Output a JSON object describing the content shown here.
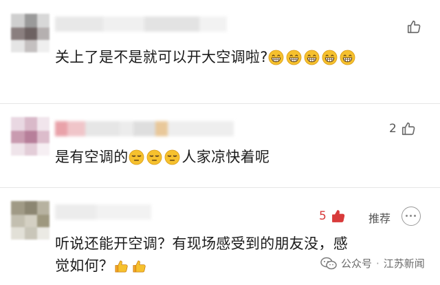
{
  "comments": [
    {
      "text": "关上了是不是就可以开大空调啦?",
      "emoji_name": "grinning-face-icon",
      "emoji_count": 5,
      "like_count": ""
    },
    {
      "text_before": "是有空调的",
      "emoji_name": "unamused-face-icon",
      "emoji_count": 3,
      "text_after": "人家凉快着呢",
      "like_count": "2"
    },
    {
      "line1": "听说还能开空调？有现场感受到的朋友没，感",
      "line2": "觉如何？",
      "emoji_name": "thumbs-up-icon",
      "emoji_count": 2,
      "like_count": "5",
      "recommend_label": "推荐"
    }
  ],
  "watermark": {
    "channel": "公众号",
    "separator": "·",
    "account": "江苏新闻"
  },
  "colors": {
    "text": "#1b1b1b",
    "like_active": "#d83a3a",
    "thumb_outline": "#6b6b6b",
    "emoji_yellow": "#f6c12e"
  }
}
